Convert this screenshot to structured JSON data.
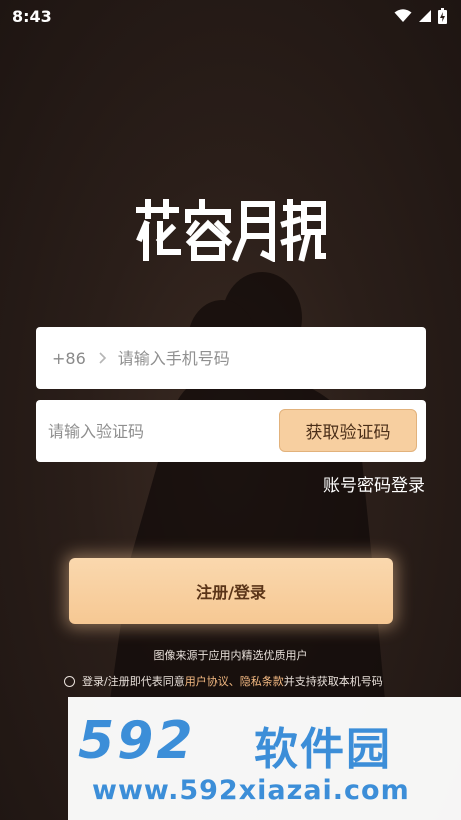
{
  "status_bar": {
    "time": "8:43",
    "icons": [
      "wifi-icon",
      "signal-icon",
      "battery-charging-icon"
    ]
  },
  "app": {
    "logo_text": "花容月貌"
  },
  "login_form": {
    "country_code": "+86",
    "phone_placeholder": "请输入手机号码",
    "code_placeholder": "请输入验证码",
    "get_code_label": "获取验证码",
    "account_login_label": "账号密码登录",
    "submit_label": "注册/登录"
  },
  "footer": {
    "image_source": "图像来源于应用内精选优质用户",
    "agreement_prefix": "登录/注册即代表同意",
    "user_agreement": "用户协议",
    "separator": "、",
    "privacy_terms": "隐私条款",
    "agreement_suffix": "并支持获取本机号码"
  },
  "watermark": {
    "number": "592",
    "name": "软件园",
    "url": "www.592xiazai.com"
  },
  "colors": {
    "background": "#2a1e19",
    "accent": "#f7cfa0",
    "link": "#f3b982",
    "watermark": "#3c8ed8"
  }
}
